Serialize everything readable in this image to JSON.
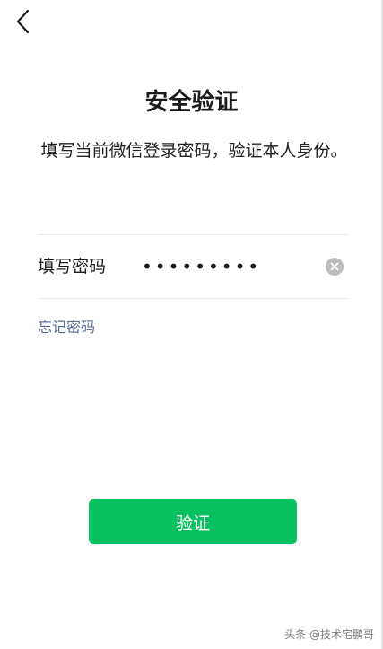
{
  "header": {
    "back_icon": "chevron-left-icon"
  },
  "main": {
    "title": "安全验证",
    "description": "填写当前微信登录密码，验证本人身份。"
  },
  "form": {
    "password_label": "填写密码",
    "password_value": "•••••••••",
    "clear_icon": "clear-circle-icon",
    "forgot_label": "忘记密码"
  },
  "actions": {
    "verify_label": "验证"
  },
  "watermark": {
    "text": "头条 @技术宅鹏哥"
  },
  "colors": {
    "primary": "#07c160",
    "link": "#576b95",
    "clear_icon": "#bdbdbd"
  }
}
